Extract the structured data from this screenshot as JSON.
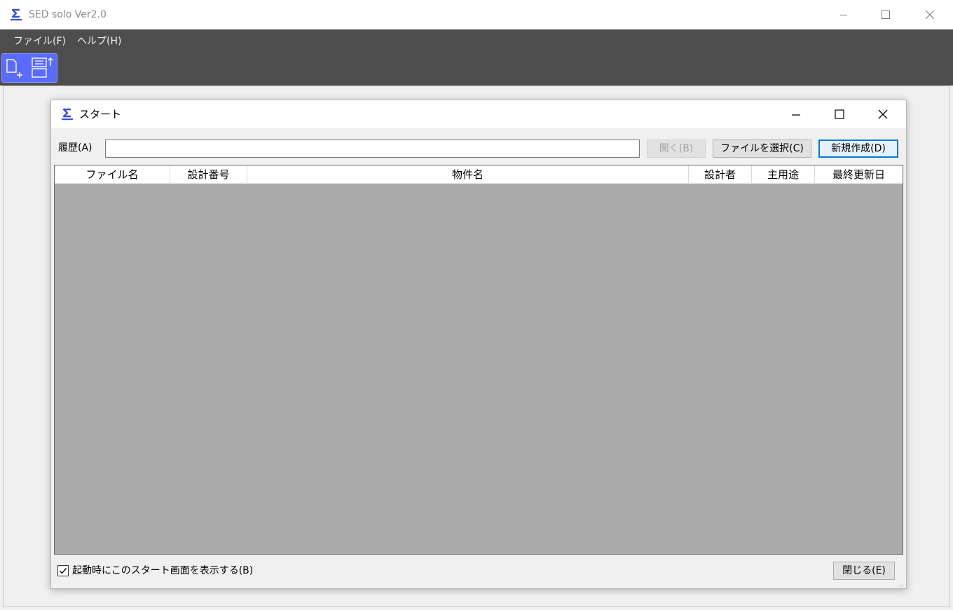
{
  "app": {
    "title": "SED solo Ver2.0",
    "icon": "sed-logo-icon",
    "brand_color": "#3a4ee0"
  },
  "window_controls": [
    "minimize-icon",
    "maximize-icon",
    "close-icon"
  ],
  "menu": {
    "items": [
      {
        "label": "ファイル(F)"
      },
      {
        "label": "ヘルプ(H)"
      }
    ]
  },
  "toolbar": {
    "buttons": [
      {
        "icon": "new-document-icon"
      },
      {
        "icon": "import-document-icon"
      }
    ],
    "accent": "#5a6bff"
  },
  "dialog": {
    "title": "スタート",
    "history": {
      "label": "履歴(A)",
      "value": "",
      "placeholder": ""
    },
    "buttons": {
      "open": "開く(B)",
      "select_file": "ファイルを選択(C)",
      "new": "新規作成(D)",
      "close": "閉じる(E)"
    },
    "table": {
      "columns": [
        "ファイル名",
        "設計番号",
        "物件名",
        "設計者",
        "主用途",
        "最終更新日"
      ],
      "rows": []
    },
    "show_on_startup": {
      "label": "起動時にこのスタート画面を表示する(B)",
      "checked": true
    }
  }
}
